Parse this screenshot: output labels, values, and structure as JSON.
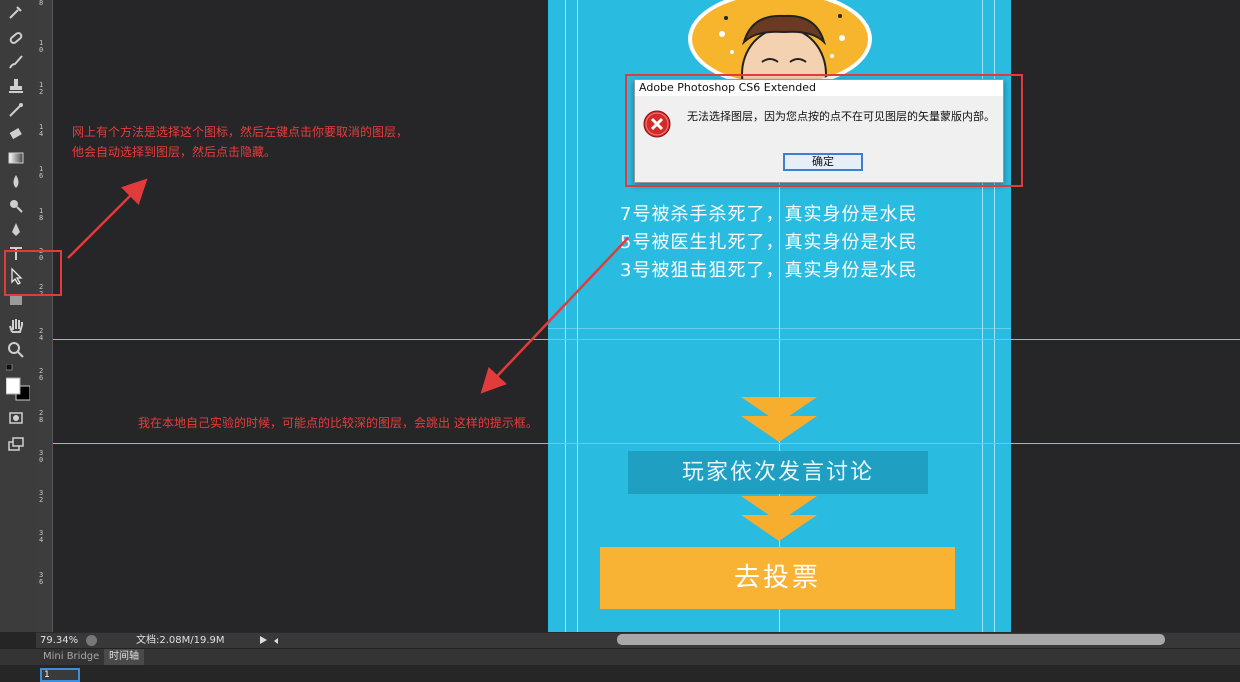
{
  "dialog": {
    "title": "Adobe Photoshop CS6 Extended",
    "message": "无法选择图层，因为您点按的点不在可见图层的矢量蒙版内部。",
    "ok_label": "确定",
    "icon": "error-icon"
  },
  "annotations": {
    "top_note_line1": "网上有个方法是选择这个图标，然后左键点击你要取消的图层，",
    "top_note_line2": "他会自动选择到图层，然后点击隐藏。",
    "bottom_note": "我在本地自己实验的时候，可能点的比较深的图层，会跳出 这样的提示框。",
    "color": "#e83c3c"
  },
  "document": {
    "story_lines": [
      "7号被杀手杀死了，真实身份是水民",
      "5号被医生扎死了，真实身份是水民",
      "3号被狙击狙死了，真实身份是水民"
    ],
    "discuss_label": "玩家依次发言讨论",
    "vote_label": "去投票",
    "background": "#29bbe0",
    "accent": "#f8b334"
  },
  "ruler": {
    "labels": [
      {
        "text": "8"
      },
      {
        "text": "1\n0"
      },
      {
        "text": "1\n2"
      },
      {
        "text": "1\n4"
      },
      {
        "text": "1\n6"
      },
      {
        "text": "1\n8"
      },
      {
        "text": "2\n0"
      },
      {
        "text": "2\n2"
      },
      {
        "text": "2\n4"
      },
      {
        "text": "2\n6"
      },
      {
        "text": "2\n8"
      },
      {
        "text": "3\n0"
      },
      {
        "text": "3\n2"
      },
      {
        "text": "3\n4"
      },
      {
        "text": "3\n6"
      }
    ]
  },
  "status": {
    "zoom": "79.34%",
    "doc_info": "文档:2.08M/19.9M"
  },
  "panels": {
    "tabs": [
      "Mini Bridge",
      "时间轴"
    ],
    "frame_number": "1"
  },
  "tools": [
    "eyedropper-icon",
    "healing-brush-icon",
    "brush-icon",
    "clone-stamp-icon",
    "history-brush-icon",
    "eraser-icon",
    "gradient-icon",
    "blur-icon",
    "dodge-icon",
    "pen-icon",
    "type-icon",
    "path-selection-icon",
    "rectangle-icon",
    "hand-icon",
    "zoom-icon",
    "color-swatches-icon",
    "quick-mask-icon",
    "screen-mode-icon"
  ]
}
